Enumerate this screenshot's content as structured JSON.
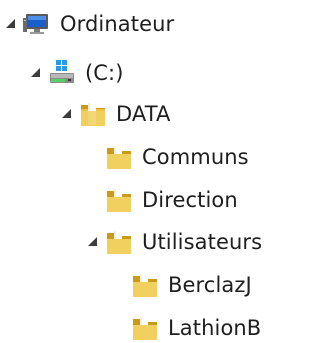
{
  "tree": {
    "computer": {
      "label": "Ordinateur",
      "icon": "computer-icon",
      "expanded": true
    },
    "drive": {
      "label": "(C:)",
      "icon": "drive-icon",
      "expanded": true
    },
    "data_folder": {
      "label": "DATA",
      "icon": "folder-icon",
      "expanded": true
    },
    "communs": {
      "label": "Communs",
      "icon": "folder-icon"
    },
    "direction": {
      "label": "Direction",
      "icon": "folder-icon"
    },
    "utilisateurs": {
      "label": "Utilisateurs",
      "icon": "folder-icon",
      "expanded": true
    },
    "berclazj": {
      "label": "BerclazJ",
      "icon": "folder-icon"
    },
    "lathionb": {
      "label": "LathionB",
      "icon": "folder-icon"
    }
  },
  "colors": {
    "folder": "#e8c547",
    "folder_dark": "#c99a1c",
    "expand_arrow": "#3c3c3c",
    "monitor_screen": "#1a5fc8",
    "drive_blue": "#2a7ad8"
  }
}
